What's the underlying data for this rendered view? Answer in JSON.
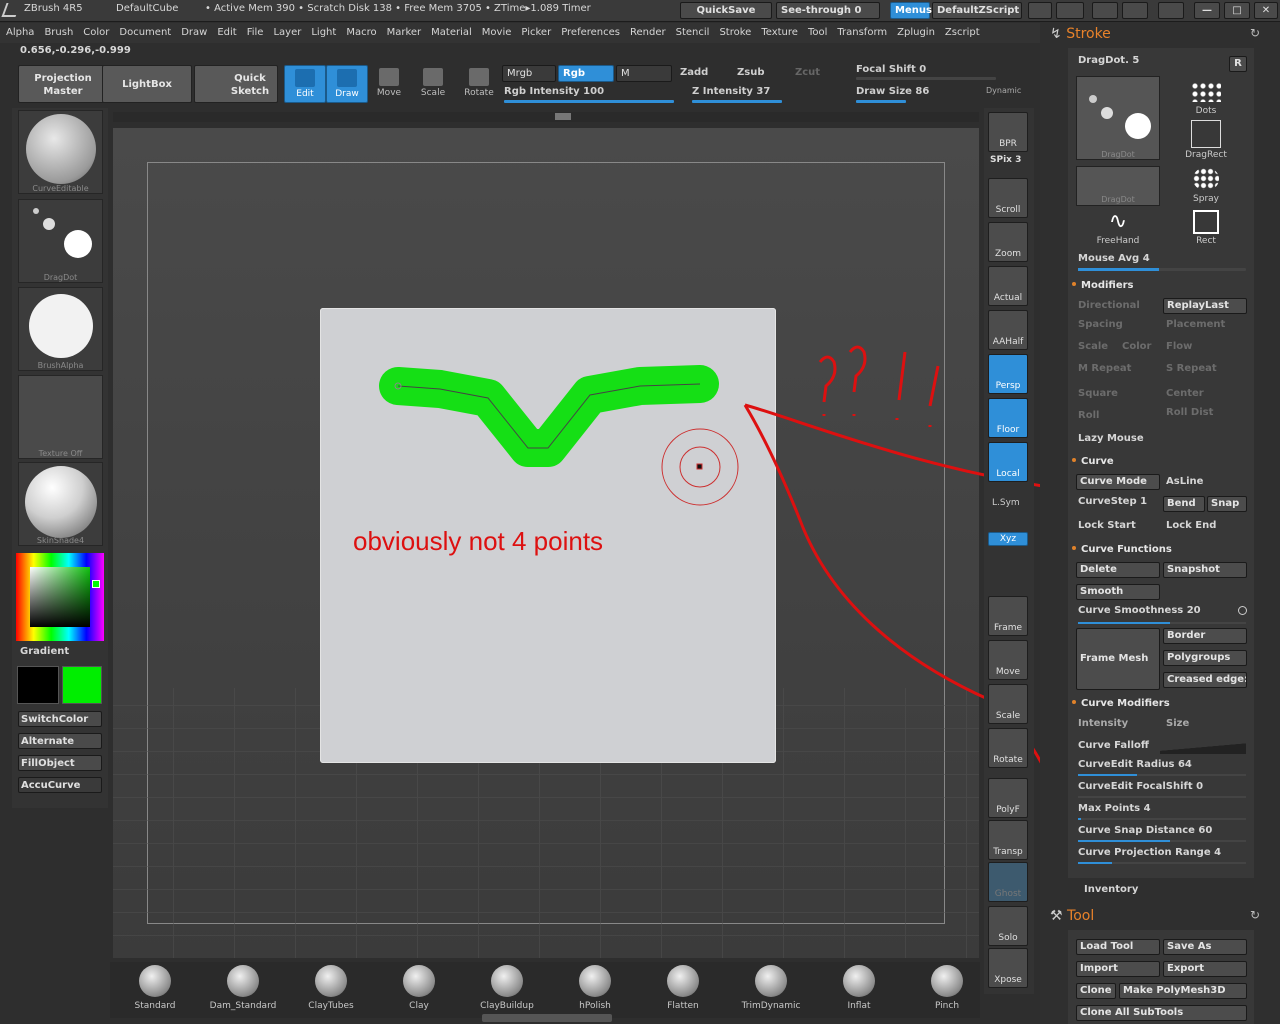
{
  "titlebar": {
    "app": "ZBrush 4R5",
    "project": "DefaultCube",
    "stats": "• Active Mem 390 • Scratch Disk 138 • Free Mem 3705 • ZTime▸1.089 Timer",
    "quicksave": "QuickSave",
    "seethrough": "See-through   0",
    "menus": "Menus",
    "script": "DefaultZScript"
  },
  "menu_items": [
    "Alpha",
    "Brush",
    "Color",
    "Document",
    "Draw",
    "Edit",
    "File",
    "Layer",
    "Light",
    "Macro",
    "Marker",
    "Material",
    "Movie",
    "Picker",
    "Preferences",
    "Render",
    "Stencil",
    "Stroke",
    "Texture",
    "Tool",
    "Transform",
    "Zplugin",
    "Zscript"
  ],
  "coords": "0.656,-0.296,-0.999",
  "top_tools": {
    "projection_master": "Projection Master",
    "lightbox": "LightBox",
    "quick_sketch": "Quick Sketch",
    "edit": "Edit",
    "draw": "Draw",
    "move": "Move",
    "scale": "Scale",
    "rotate": "Rotate",
    "mrgb": "Mrgb",
    "rgb": "Rgb",
    "m": "M",
    "zadd": "Zadd",
    "zsub": "Zsub",
    "zcut": "Zcut",
    "rgb_intensity": "Rgb Intensity 100",
    "z_intensity": "Z Intensity 37",
    "focal_shift": "Focal Shift 0",
    "draw_size": "Draw Size 86",
    "dynamic": "Dynamic"
  },
  "left_panel": {
    "thumbs": [
      "CurveEditable",
      "DragDot",
      "BrushAlpha",
      "Texture Off",
      "SkinShade4"
    ],
    "gradient": "Gradient",
    "switchcolor": "SwitchColor",
    "alternate": "Alternate",
    "fillobject": "FillObject",
    "accucurve": "AccuCurve"
  },
  "right_tools": [
    "BPR",
    "SPix 3",
    "Scroll",
    "Zoom",
    "Actual",
    "AAHalf",
    "Persp",
    "Floor",
    "Local",
    "L.Sym",
    "Xyz",
    "Frame",
    "Move",
    "Scale",
    "Rotate",
    "PolyF",
    "Transp",
    "Ghost",
    "Solo",
    "Xpose"
  ],
  "stroke_panel": {
    "title": "Stroke",
    "dragdot": "DragDot. 5",
    "r": "R",
    "stroke_types": [
      "DragDot",
      "DragRect",
      "DragDot",
      "Spray",
      "FreeHand",
      "Rect",
      "Dots"
    ],
    "mouse_avg": "Mouse Avg 4",
    "modifiers": "Modifiers",
    "directional": "Directional",
    "replaylast": "ReplayLast",
    "spacing": "Spacing",
    "placement": "Placement",
    "scale": "Scale",
    "color": "Color",
    "flow": "Flow",
    "m_repeat": "M Repeat",
    "s_repeat": "S Repeat",
    "square": "Square",
    "center": "Center",
    "roll": "Roll",
    "roll_dist": "Roll Dist",
    "lazy_mouse": "Lazy Mouse",
    "curve": "Curve",
    "curve_mode": "Curve Mode",
    "asline": "AsLine",
    "curvestep": "CurveStep 1",
    "bend": "Bend",
    "snap": "Snap",
    "lock_start": "Lock Start",
    "lock_end": "Lock End",
    "curve_functions": "Curve Functions",
    "delete": "Delete",
    "snapshot": "Snapshot",
    "smooth": "Smooth",
    "curve_smoothness": "Curve Smoothness 20",
    "frame_mesh": "Frame Mesh",
    "border": "Border",
    "polygroups": "Polygroups",
    "creased_edges": "Creased edge:",
    "curve_modifiers": "Curve Modifiers",
    "intensity": "Intensity",
    "size": "Size",
    "curve_falloff": "Curve Falloff",
    "curveedit_radius": "CurveEdit Radius 64",
    "curveedit_focalshift": "CurveEdit FocalShift 0",
    "max_points": "Max Points 4",
    "curve_snap_distance": "Curve Snap Distance 60",
    "curve_projection_range": "Curve Projection Range 4",
    "inventory": "Inventory"
  },
  "tool_panel": {
    "title": "Tool",
    "load_tool": "Load Tool",
    "save_as": "Save As",
    "import": "Import",
    "export": "Export",
    "clone": "Clone",
    "make_polymesh": "Make PolyMesh3D",
    "clone_all": "Clone All SubTools"
  },
  "annotation": "obviously not 4 points",
  "brushes": [
    "Standard",
    "Dam_Standard",
    "ClayTubes",
    "Clay",
    "ClayBuildup",
    "hPolish",
    "Flatten",
    "TrimDynamic",
    "Inflat",
    "Pinch"
  ],
  "colors": {
    "accent": "#2f8fd8",
    "stroke_green": "#00e000",
    "annotation_red": "#dd1010",
    "panel_title": "#e8822a"
  }
}
